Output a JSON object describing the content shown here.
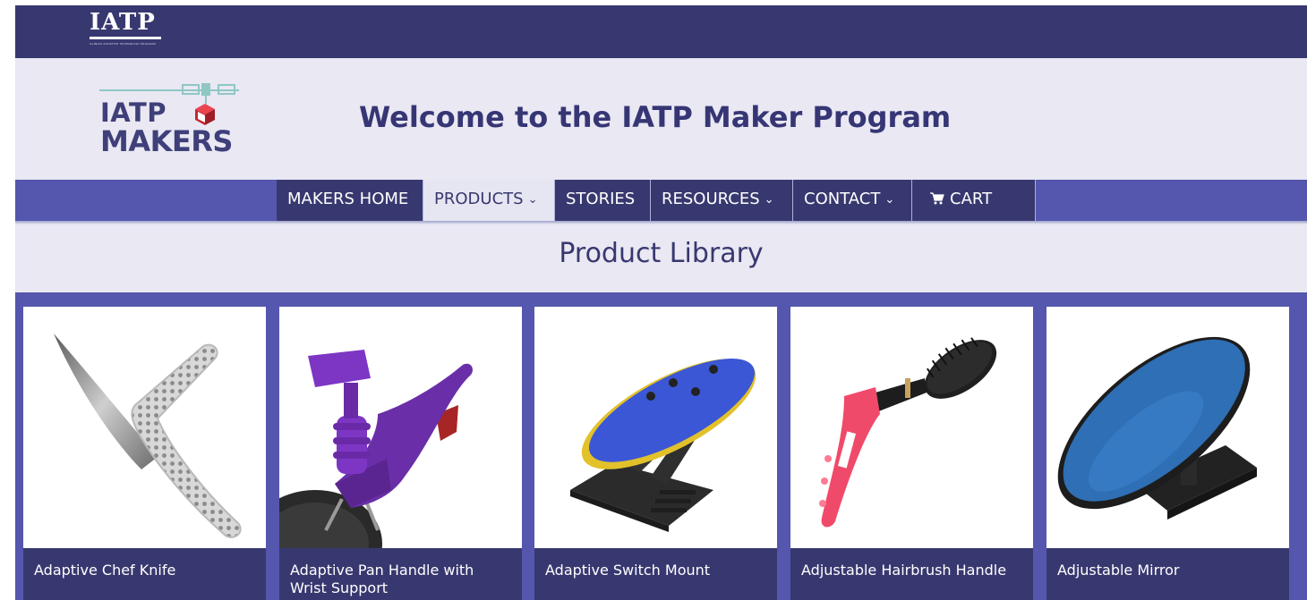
{
  "site": {
    "top_logo_text": "IATP",
    "top_logo_subtext": "ILLINOIS ASSISTIVE TECHNOLOGY PROGRAM",
    "makers_logo_line1": "IATP",
    "makers_logo_line2": "MAKERS",
    "welcome_title": "Welcome to the IATP Maker Program"
  },
  "nav": {
    "items": [
      {
        "label": "MAKERS HOME"
      },
      {
        "label": "PRODUCTS",
        "chevron": "⌄"
      },
      {
        "label": "STORIES"
      },
      {
        "label": "RESOURCES",
        "chevron": "⌄"
      },
      {
        "label": "CONTACT",
        "chevron": "⌄"
      },
      {
        "label": "CART"
      }
    ],
    "active": "PRODUCTS"
  },
  "library": {
    "title": "Product Library"
  },
  "products": [
    {
      "name": "Adaptive Chef Knife",
      "icon": "chef-knife-image"
    },
    {
      "name": "Adaptive Pan Handle with Wrist Support",
      "icon": "pan-handle-image"
    },
    {
      "name": "Adaptive Switch Mount",
      "icon": "switch-mount-image"
    },
    {
      "name": "Adjustable Hairbrush Handle",
      "icon": "hairbrush-handle-image"
    },
    {
      "name": "Adjustable Mirror",
      "icon": "mirror-image"
    }
  ],
  "colors": {
    "dark_navy": "#383870",
    "nav_blue": "#5457ad",
    "header_bg": "#e9e8f3",
    "logo_red": "#d4343f"
  }
}
